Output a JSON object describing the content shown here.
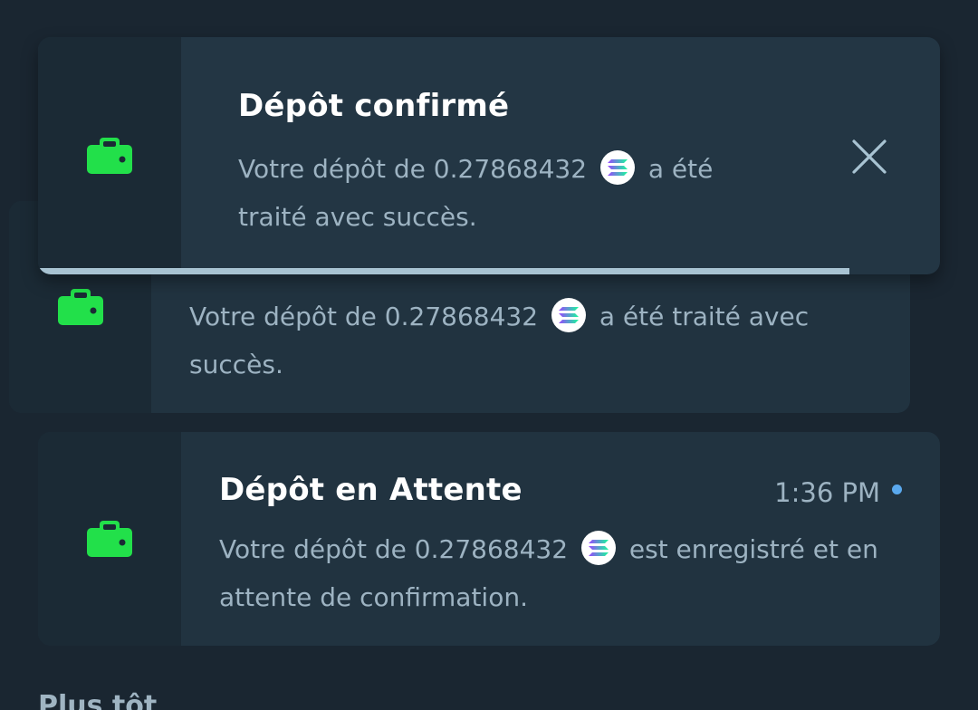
{
  "colors": {
    "background": "#1a2631",
    "card": "#213340",
    "icon_column": "#1b2a35",
    "wallet_icon": "#22e04a",
    "progress_bar": "#a8c3d2",
    "unread_dot": "#5aa9ee"
  },
  "icons": {
    "wallet": "wallet-icon",
    "currency": "solana-icon",
    "close": "close-icon"
  },
  "toast": {
    "title": "Dépôt confirmé",
    "msg_prefix": "Votre dépôt de 0.27868432",
    "msg_suffix": "a été traité avec succès.",
    "progress": 0.9
  },
  "notifications": [
    {
      "msg_prefix": "Votre dépôt de 0.27868432",
      "msg_suffix": "a été traité avec succès."
    },
    {
      "title": "Dépôt en Attente",
      "time": "1:36 PM",
      "unread": true,
      "msg_prefix": "Votre dépôt de 0.27868432",
      "msg_suffix": "est enregistré et en attente de confirmation."
    }
  ],
  "section": {
    "label": "Plus tôt"
  }
}
